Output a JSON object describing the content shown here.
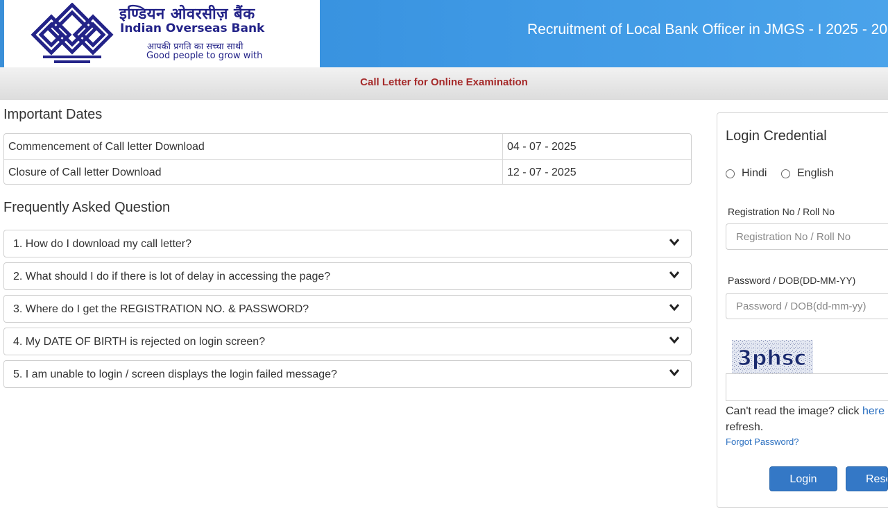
{
  "header": {
    "bank_name_hindi": "इण्डियन ओवरसीज़ बैंक",
    "bank_name": "Indian Overseas Bank",
    "tagline_hindi": "आपकी प्रगति का सच्चा साथी",
    "tagline": "Good people to grow with",
    "title": "Recruitment of Local Bank Officer in JMGS - I 2025 - 20"
  },
  "subbar": {
    "label": "Call Letter for Online Examination"
  },
  "important_dates": {
    "heading": "Important Dates",
    "rows": [
      {
        "label": "Commencement of Call letter Download",
        "date": "04 - 07 - 2025"
      },
      {
        "label": "Closure of Call letter Download",
        "date": "12 - 07 - 2025"
      }
    ]
  },
  "faq": {
    "heading": "Frequently Asked Question",
    "items": [
      "1. How do I download my call letter?",
      "2. What should I do if there is lot of delay in accessing the page?",
      "3. Where do I get the REGISTRATION NO. & PASSWORD?",
      "4. My DATE OF BIRTH is rejected on login screen?",
      "5. I am unable to login / screen displays the login failed message?"
    ]
  },
  "login": {
    "title": "Login Credential",
    "lang_hindi": "Hindi",
    "lang_english": "English",
    "reg_label": "Registration No / Roll No",
    "reg_placeholder": "Registration No / Roll No",
    "pwd_label": "Password / DOB(DD-MM-YY)",
    "pwd_placeholder": "Password / DOB(dd-mm-yy)",
    "captcha_text": "3phsc",
    "cant_read": "Can't read the image? click ",
    "cant_read_link": "here",
    "refresh": "refresh.",
    "forgot": "Forgot Password?",
    "login_button": "Login",
    "reset_button": "Reset"
  },
  "colors": {
    "header_blue": "#3e98e4",
    "accent_red": "#a52a2a",
    "button_blue": "#3478c6",
    "link_blue": "#2a6fc0"
  }
}
